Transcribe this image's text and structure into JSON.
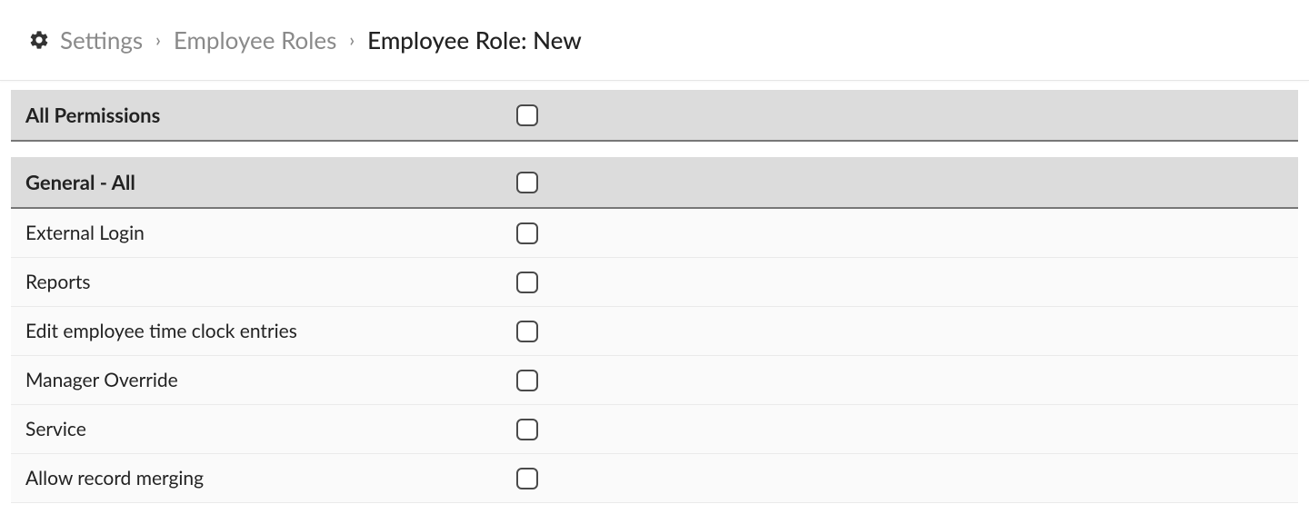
{
  "breadcrumb": {
    "items": [
      {
        "label": "Settings"
      },
      {
        "label": "Employee Roles"
      }
    ],
    "current": "Employee Role: New"
  },
  "permissions": {
    "allPermissions": {
      "label": "All Permissions",
      "checked": false
    },
    "groups": [
      {
        "label": "General - All",
        "checked": false,
        "items": [
          {
            "label": "External Login",
            "checked": false
          },
          {
            "label": "Reports",
            "checked": false
          },
          {
            "label": "Edit employee time clock entries",
            "checked": false
          },
          {
            "label": "Manager Override",
            "checked": false
          },
          {
            "label": "Service",
            "checked": false
          },
          {
            "label": "Allow record merging",
            "checked": false
          }
        ]
      }
    ]
  }
}
